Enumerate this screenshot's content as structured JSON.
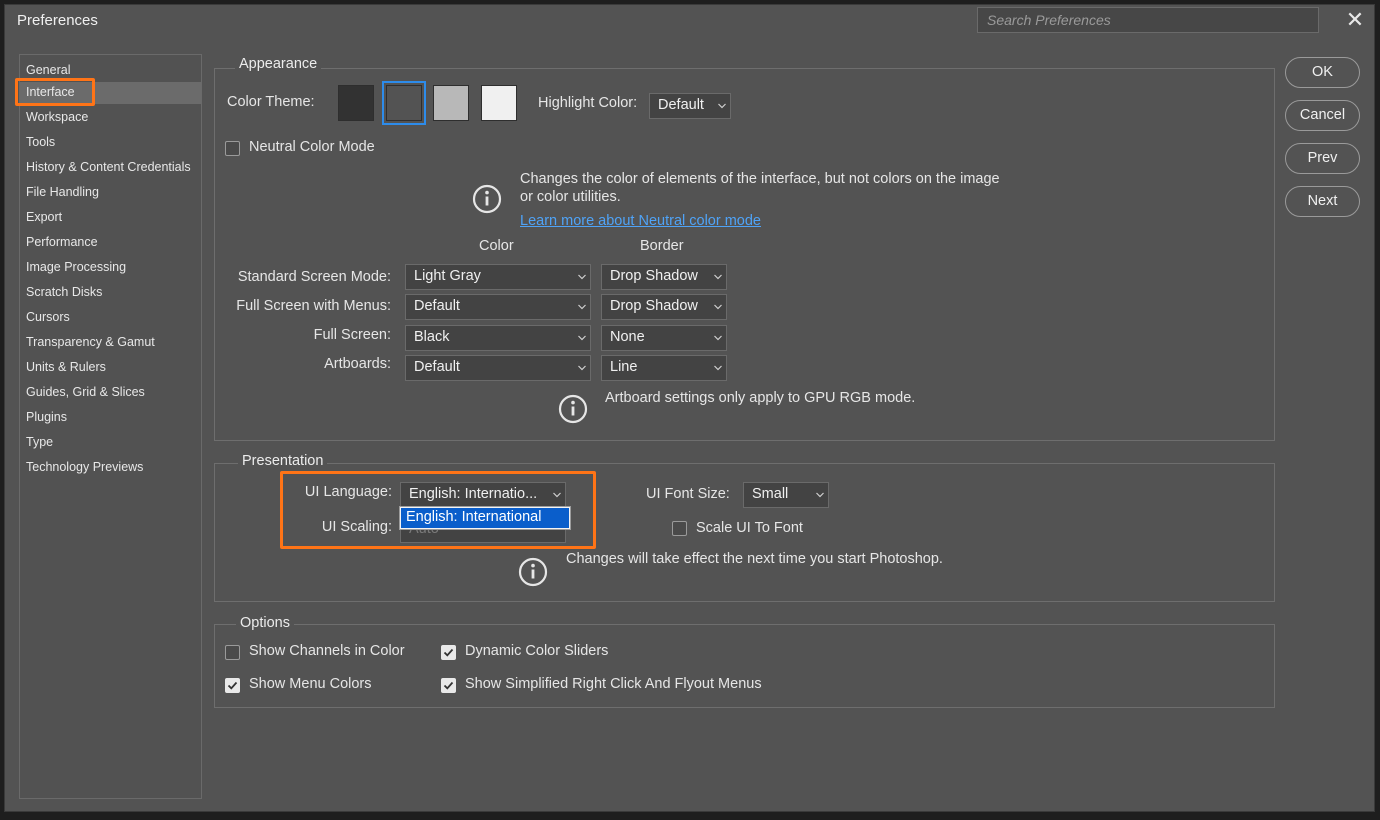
{
  "window": {
    "title": "Preferences",
    "search_placeholder": "Search Preferences",
    "close_glyph": "✕"
  },
  "sidebar": {
    "items": [
      {
        "label": "General"
      },
      {
        "label": "Interface"
      },
      {
        "label": "Workspace"
      },
      {
        "label": "Tools"
      },
      {
        "label": "History & Content Credentials"
      },
      {
        "label": "File Handling"
      },
      {
        "label": "Export"
      },
      {
        "label": "Performance"
      },
      {
        "label": "Image Processing"
      },
      {
        "label": "Scratch Disks"
      },
      {
        "label": "Cursors"
      },
      {
        "label": "Transparency & Gamut"
      },
      {
        "label": "Units & Rulers"
      },
      {
        "label": "Guides, Grid & Slices"
      },
      {
        "label": "Plugins"
      },
      {
        "label": "Type"
      },
      {
        "label": "Technology Previews"
      }
    ],
    "selected": "Interface"
  },
  "appearance": {
    "title": "Appearance",
    "color_theme_label": "Color Theme:",
    "swatches": [
      "#323232",
      "#535353",
      "#b8b8b8",
      "#f0f0f0"
    ],
    "selected_swatch_index": 1,
    "highlight_label": "Highlight Color:",
    "highlight_value": "Default",
    "neutral_label": "Neutral Color Mode",
    "neutral_checked": false,
    "neutral_info": "Changes the color of elements of the interface, but not colors on the image or color utilities.",
    "neutral_link": "Learn more about Neutral color mode",
    "col_color": "Color",
    "col_border": "Border",
    "rows": [
      {
        "label": "Standard Screen Mode:",
        "color": "Light Gray",
        "border": "Drop Shadow"
      },
      {
        "label": "Full Screen with Menus:",
        "color": "Default",
        "border": "Drop Shadow"
      },
      {
        "label": "Full Screen:",
        "color": "Black",
        "border": "None"
      },
      {
        "label": "Artboards:",
        "color": "Default",
        "border": "Line"
      }
    ],
    "artboard_note": "Artboard settings only apply to GPU RGB mode."
  },
  "presentation": {
    "title": "Presentation",
    "ui_language_label": "UI Language:",
    "ui_language_value": "English:  Internatio...",
    "ui_language_option": "English: International",
    "ui_scaling_label": "UI Scaling:",
    "ui_scaling_value": "Auto",
    "ui_font_size_label": "UI Font Size:",
    "ui_font_size_value": "Small",
    "scale_ui_label": "Scale UI To Font",
    "scale_ui_checked": false,
    "note": "Changes will take effect the next time you start Photoshop."
  },
  "options": {
    "title": "Options",
    "items": [
      {
        "label": "Show Channels in Color",
        "checked": false
      },
      {
        "label": "Dynamic Color Sliders",
        "checked": true
      },
      {
        "label": "Show Menu Colors",
        "checked": true
      },
      {
        "label": "Show Simplified Right Click And Flyout Menus",
        "checked": true
      }
    ]
  },
  "buttons": {
    "ok": "OK",
    "cancel": "Cancel",
    "prev": "Prev",
    "next": "Next"
  },
  "colors": {
    "accent_highlight": "#ff7417",
    "selection_blue": "#0a5ecb",
    "link": "#4fa3f7"
  },
  "icons": [
    "close-icon",
    "info-icon",
    "chevron-down-icon",
    "checkmark-icon"
  ]
}
